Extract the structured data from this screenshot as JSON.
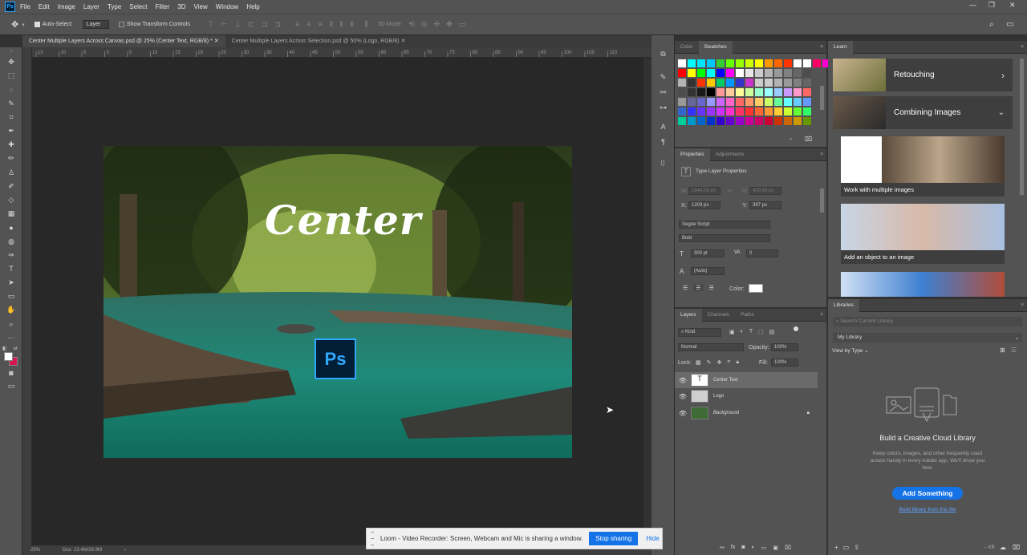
{
  "app": {
    "logo": "Ps"
  },
  "menubar": {
    "items": [
      "File",
      "Edit",
      "Image",
      "Layer",
      "Type",
      "Select",
      "Filter",
      "3D",
      "View",
      "Window",
      "Help"
    ]
  },
  "window_controls": [
    "—",
    "❐",
    "✕"
  ],
  "options": {
    "auto_select_label": "Auto-Select:",
    "auto_select_value": "Layer",
    "transform_label": "Show Transform Controls",
    "mode_label": "3D Mode:"
  },
  "tabs": [
    {
      "label": "Center Multiple Layers Across Canvas.psd @ 25% (Center Text, RGB/8) *"
    },
    {
      "label": "Center Multiple Layers Across Selection.psd @ 50% (Logo, RGB/8)"
    }
  ],
  "ruler_labels": [
    "15",
    "10",
    "5",
    "0",
    "5",
    "10",
    "15",
    "20",
    "25",
    "30",
    "35",
    "40",
    "45",
    "50",
    "55",
    "60",
    "65",
    "70",
    "75",
    "80",
    "85",
    "90",
    "95",
    "100",
    "105",
    "110"
  ],
  "canvas": {
    "center_text": "Center",
    "logo_text": "Ps"
  },
  "status": {
    "zoom": "25%",
    "doc": "Doc: 23.4M/26.9M"
  },
  "color_panel": {
    "tabs": [
      "Color",
      "Swatches"
    ]
  },
  "properties": {
    "tabs": [
      "Properties",
      "Adjustments"
    ],
    "title": "Type Layer Properties",
    "w_label": "W:",
    "w_value": "1844.58 px",
    "h_label": "H:",
    "h_value": "400.85 px",
    "x_label": "X:",
    "x_value": "1203 px",
    "y_label": "Y:",
    "y_value": "397 px",
    "font_family": "Segoe Script",
    "font_style": "Bold",
    "font_size": "300 pt",
    "tracking": "0",
    "leading": "(Auto)",
    "color_label": "Color:",
    "text_color": "#ffffff"
  },
  "layers_panel": {
    "tabs": [
      "Layers",
      "Channels",
      "Paths"
    ],
    "filter_label": "Kind",
    "blend_mode": "Normal",
    "opacity_label": "Opacity:",
    "opacity_value": "100%",
    "lock_label": "Lock:",
    "fill_label": "Fill:",
    "fill_value": "100%",
    "layers": [
      {
        "name": "Center Text",
        "selected": true
      },
      {
        "name": "Logo",
        "selected": false
      },
      {
        "name": "Background",
        "selected": false
      }
    ]
  },
  "learn_panel": {
    "title": "Learn",
    "items": [
      {
        "label": "Retouching"
      },
      {
        "label": "Combining Images"
      }
    ],
    "cards": [
      {
        "label": "Work with multiple images"
      },
      {
        "label": "Add an object to an image"
      }
    ]
  },
  "libraries_panel": {
    "title": "Libraries",
    "search_placeholder": "Search Current Library",
    "library_name": "My Library",
    "view_label": "View by Type",
    "heading": "Build a Creative Cloud Library",
    "body": "Keep colors, images, and other frequently used assets handy in every Adobe app. We'll show you how.",
    "button": "Add Something",
    "link": "Build library from this file",
    "footer_size": "-- KB"
  },
  "share_bar": {
    "message": "Loom - Video Recorder: Screen, Webcam and Mic is sharing a window.",
    "stop_label": "Stop sharing",
    "hide_label": "Hide"
  },
  "colors": {
    "accent_blue": "#1473e6",
    "ps_blue": "#31a8ff",
    "foreground": "#ffffff",
    "background_color": "#d6174f"
  },
  "swatch_colors": [
    [
      "#ffffff",
      "#00ffff",
      "#00e5ff",
      "#00c8ff",
      "#33cc33",
      "#66ff00",
      "#99ff00",
      "#ccff00",
      "#ffff00",
      "#ff9900",
      "#ff6600",
      "#ff3300",
      "#ffffff",
      "#ffffff",
      "#ff0066",
      "#ff00cc"
    ],
    [
      "#ff0000",
      "#ffff00",
      "#00ff00",
      "#00ffff",
      "#0000ff",
      "#ff00ff",
      "#ffffff",
      "#e6e6e6",
      "#cccccc",
      "#b3b3b3",
      "#999999",
      "#808080",
      "#666666",
      "#4d4d4d",
      "",
      ""
    ],
    [
      "#b3b3b3",
      "#333333",
      "#ff3300",
      "#ffcc00",
      "#00cc66",
      "#0099ff",
      "#3333cc",
      "#cc33cc",
      "#cccccc",
      "#cccccc",
      "#b3b3b3",
      "#999999",
      "#808080",
      "#666666",
      "",
      ""
    ],
    [
      "#4d4d4d",
      "#333333",
      "#1a1a1a",
      "#000000",
      "#ff9999",
      "#ffcc99",
      "#ffff99",
      "#ccff99",
      "#99ffcc",
      "#99ffff",
      "#99ccff",
      "#cc99ff",
      "#ff99cc",
      "#ff6666",
      "",
      ""
    ],
    [
      "#999999",
      "#666699",
      "#6666cc",
      "#9999ff",
      "#cc66ff",
      "#ff66cc",
      "#ff6666",
      "#ff9966",
      "#ffcc66",
      "#ccff66",
      "#66ff99",
      "#66ffff",
      "#66ccff",
      "#6699ff",
      "",
      ""
    ],
    [
      "#3366cc",
      "#3333ff",
      "#6633ff",
      "#9933ff",
      "#cc33ff",
      "#ff33cc",
      "#ff3366",
      "#ff3333",
      "#ff6633",
      "#ff9933",
      "#ffcc33",
      "#ccff33",
      "#66ff33",
      "#33ff66",
      "",
      ""
    ],
    [
      "#00cc99",
      "#0099cc",
      "#0066cc",
      "#0033cc",
      "#3300cc",
      "#6600cc",
      "#9900cc",
      "#cc0099",
      "#cc0066",
      "#cc0033",
      "#cc3300",
      "#cc6600",
      "#cc9900",
      "#669900",
      "",
      ""
    ]
  ]
}
